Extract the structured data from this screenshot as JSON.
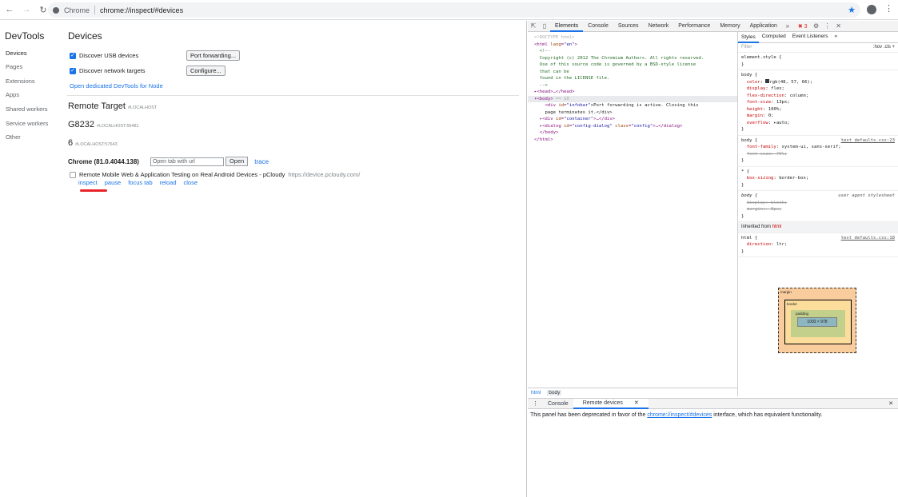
{
  "browser": {
    "omnibox_chip": "Chrome",
    "url": "chrome://inspect/#devices"
  },
  "sidebar": {
    "title": "DevTools",
    "items": [
      "Devices",
      "Pages",
      "Extensions",
      "Apps",
      "Shared workers",
      "Service workers",
      "Other"
    ]
  },
  "devices": {
    "title": "Devices",
    "usb_label": "Discover USB devices",
    "port_btn": "Port forwarding...",
    "network_label": "Discover network targets",
    "configure_btn": "Configure...",
    "node_link": "Open dedicated DevTools for Node",
    "remote_title": "Remote Target",
    "remote_host": "#LOCALHOST",
    "device1": "G8232",
    "device1_host": "#LOCALHOST:56481",
    "device2": "6",
    "device2_host": "#LOCALHOST:57643",
    "chrome_version": "Chrome (81.0.4044.138)",
    "url_placeholder": "Open tab with url",
    "open_btn": "Open",
    "trace": "trace",
    "target_title": "Remote Mobile Web & Application Testing on Real Android Devices - pCloudy",
    "target_url": "https://device.pcloudy.com/",
    "actions": [
      "inspect",
      "pause",
      "focus tab",
      "reload",
      "close"
    ]
  },
  "devtools": {
    "tabs": [
      "Elements",
      "Console",
      "Sources",
      "Network",
      "Performance",
      "Memory",
      "Application"
    ],
    "error_count": "3",
    "elements": {
      "l1": "<!DOCTYPE html>",
      "l2_tag": "<html ",
      "l2_attr": "lang",
      "l2_val": "\"en\"",
      "l3": "<!--",
      "l4": "Copyright (c) 2012 The Chromium Authors. All rights reserved.",
      "l5": "Use of this source code is governed by a BSD-style license",
      "l6": "that can be",
      "l7": "found in the LICENSE file.",
      "l8": "-->",
      "l9": "<head>…</head>",
      "l10": "<body>",
      "l10b": "== $0",
      "l11a": "<div ",
      "l11b": "id",
      "l11c": "\"infobar\"",
      "l11d": ">Port forwarding is active. Closing this",
      "l12": "page terminates it.</div>",
      "l13a": "<div ",
      "l13b": "id",
      "l13c": "\"container\"",
      "l13d": ">…</div>",
      "l14a": "<dialog ",
      "l14b": "id",
      "l14c": "\"config-dialog\"",
      "l14d": " class",
      "l14e": "\"config\"",
      "l14f": ">…</dialog>",
      "l15": "</body>",
      "l16": "</html>"
    },
    "breadcrumbs": [
      "html",
      "body"
    ],
    "styles_tabs": [
      "Styles",
      "Computed",
      "Event Listeners"
    ],
    "filter_placeholder": "Filter",
    "hov": ":hov",
    "cls": ".cls",
    "element_style": "element.style {",
    "body_rule": {
      "selector": "body {",
      "color_prop": "color",
      "color_val": "rgb(48, 57, 66);",
      "display_prop": "display",
      "display_val": "flex;",
      "flexdir_prop": "flex-direction",
      "flexdir_val": "column;",
      "fontsize_prop": "font-size",
      "fontsize_val": "13px;",
      "height_prop": "height",
      "height_val": "100%;",
      "margin_prop": "margin",
      "margin_val": "0;",
      "overflow_prop": "overflow",
      "overflow_val": "auto;"
    },
    "body_rule2": {
      "selector": "body {",
      "src": "text_defaults.css:23",
      "ff_prop": "font-family",
      "ff_val": "system-ui, sans-serif;",
      "fs_strike": "font-size: 75%;"
    },
    "star_rule": {
      "selector": "* {",
      "prop": "box-sizing",
      "val": "border-box;"
    },
    "ua_rule": {
      "selector": "body {",
      "src": "user agent stylesheet",
      "d1": "display: block;",
      "d2": "margin:▸ 8px;"
    },
    "inherited": "Inherited from",
    "inherited_tag": "html",
    "html_rule": {
      "selector": "html {",
      "src": "text_defaults.css:18",
      "prop": "direction",
      "val": "ltr;"
    },
    "boxmodel": {
      "margin": "margin",
      "border": "border",
      "padding": "padding",
      "content": "1093 × 978",
      "dash": "-"
    },
    "drawer_tabs": [
      "Console",
      "Remote devices"
    ],
    "drawer_msg_pre": "This panel has been deprecated in favor of the",
    "drawer_msg_link": "chrome://inspect/#devices",
    "drawer_msg_post": "interface, which has equivalent functionality."
  }
}
